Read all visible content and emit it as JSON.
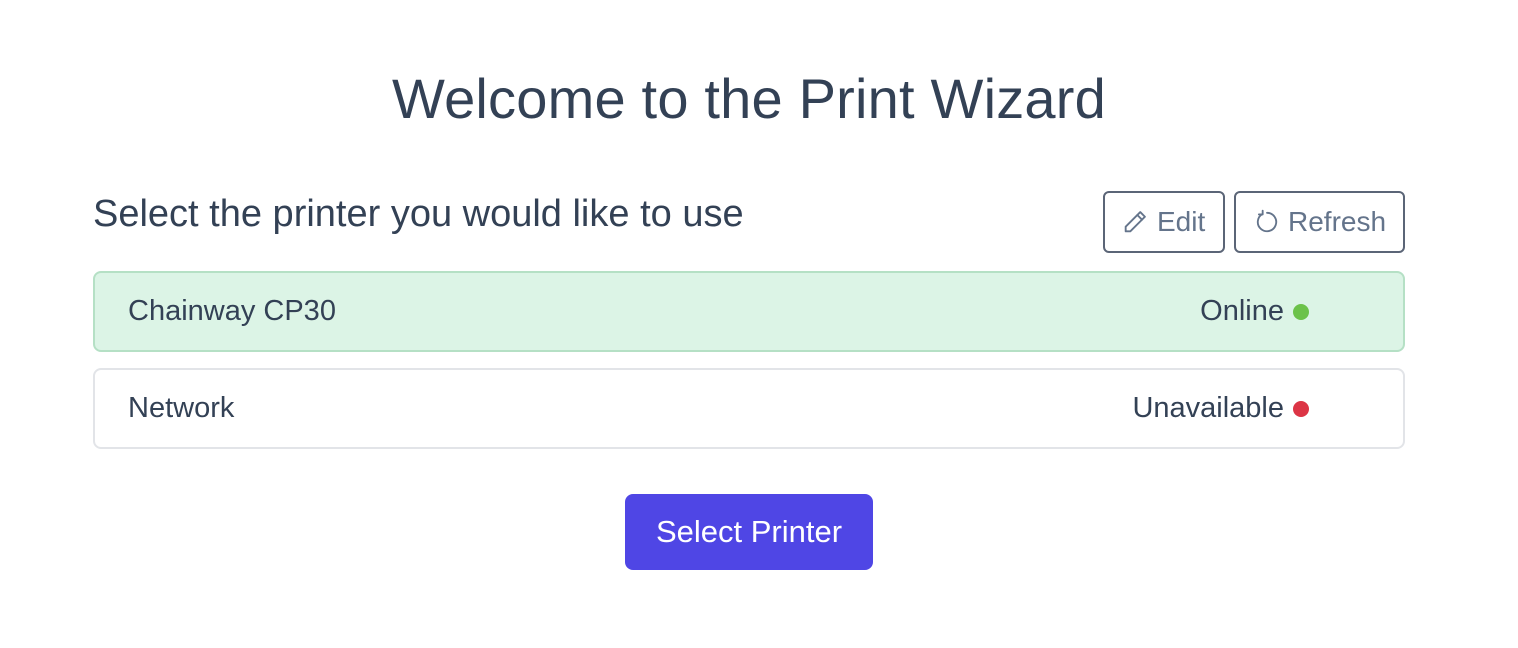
{
  "page": {
    "title": "Welcome to the Print Wizard",
    "subtitle": "Select the printer you would like to use"
  },
  "toolbar": {
    "edit_label": "Edit",
    "edit_icon": "pencil-icon",
    "refresh_label": "Refresh",
    "refresh_icon": "refresh-icon"
  },
  "printers": [
    {
      "name": "Chainway CP30",
      "status": "Online",
      "status_color": "#6cc24a",
      "selected": true
    },
    {
      "name": "Network",
      "status": "Unavailable",
      "status_color": "#dc3545",
      "selected": false
    }
  ],
  "actions": {
    "select_label": "Select Printer"
  },
  "colors": {
    "primary": "#4f46e5",
    "selected_row_bg": "#dcf4e6",
    "text": "#334155"
  }
}
